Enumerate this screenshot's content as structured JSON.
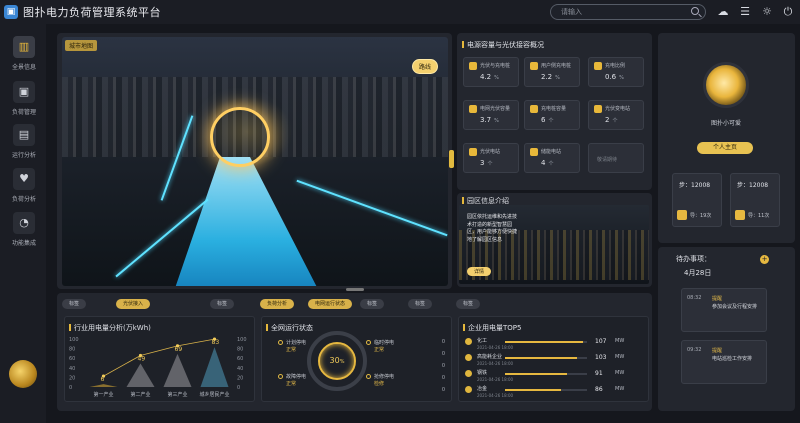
{
  "app": {
    "title": "图扑电力负荷管理系统平台",
    "search_placeholder": "请输入"
  },
  "sidebar": {
    "items": [
      {
        "label": "全景信息",
        "icon": "overview-icon"
      },
      {
        "label": "负荷管理",
        "icon": "monitor-icon"
      },
      {
        "label": "运行分析",
        "icon": "analysis-icon"
      },
      {
        "label": "负荷分析",
        "icon": "heart-icon"
      },
      {
        "label": "功能集成",
        "icon": "pie-icon"
      }
    ]
  },
  "scene": {
    "tag": "城市地图",
    "button": "路线"
  },
  "capacity": {
    "title": "电源容量与光伏接容概况",
    "cards": [
      {
        "label": "光伏与充电桩",
        "value": "4.2",
        "unit": "%"
      },
      {
        "label": "用户侧充电桩",
        "value": "2.2",
        "unit": "%"
      },
      {
        "label": "充电比例",
        "value": "0.6",
        "unit": "%"
      },
      {
        "label": "电网光伏容量",
        "value": "3.7",
        "unit": "%"
      },
      {
        "label": "充电桩容量",
        "value": "6",
        "unit": "个"
      },
      {
        "label": "光伏变电站",
        "value": "2",
        "unit": "个"
      },
      {
        "label": "光伏电站",
        "value": "3",
        "unit": "个"
      },
      {
        "label": "储能电站",
        "value": "4",
        "unit": "个"
      }
    ],
    "empty_label": "敬请期待"
  },
  "intro": {
    "title": "园区信息介绍",
    "text": "园区依托运维和先进技术打造的新型智慧园区，用户能够方便快捷地了解园区信息",
    "button": "详情"
  },
  "tabs": [
    {
      "label": "标签",
      "active": false
    },
    {
      "label": "光伏接入",
      "active": true
    },
    {
      "label": "标签",
      "active": false
    },
    {
      "label": "负荷分析",
      "active": true
    },
    {
      "label": "电网运行状态",
      "active": true
    },
    {
      "label": "标签",
      "active": false
    },
    {
      "label": "标签",
      "active": false
    },
    {
      "label": "标签",
      "active": false
    }
  ],
  "chart_panel": {
    "title": "行业用电量分析(万kWh)",
    "left_ticks": [
      "100",
      "80",
      "60",
      "40",
      "20",
      "0"
    ],
    "right_ticks": [
      "100",
      "80",
      "60",
      "40",
      "20",
      "0"
    ]
  },
  "chart_data": {
    "type": "area",
    "title": "行业用电量分析(万kWh)",
    "categories": [
      "第一产业",
      "第二产业",
      "第三产业",
      "城乡居民产业"
    ],
    "values": [
      6,
      49,
      69,
      83
    ],
    "ylim": [
      0,
      100
    ]
  },
  "gauge_panel": {
    "title": "全网运行状态",
    "value": "30",
    "unit": "%",
    "legend": [
      {
        "label": "计划停电",
        "status": "正常"
      },
      {
        "label": "故障停电",
        "status": "正常"
      },
      {
        "label": "临时停电",
        "status": "正常"
      },
      {
        "label": "抢修停电",
        "status": "检修"
      }
    ],
    "scale": [
      "0",
      "0",
      "0",
      "0",
      "0"
    ]
  },
  "ranking": {
    "title": "企业用电量TOP5",
    "rows": [
      {
        "name": "化工",
        "date": "2021-04-26 18:00",
        "value": "107",
        "unit": "MW",
        "pct": 95
      },
      {
        "name": "高能耗企业",
        "date": "2021-04-26 18:00",
        "value": "103",
        "unit": "MW",
        "pct": 88
      },
      {
        "name": "钢铁",
        "date": "2021-04-26 18:00",
        "value": "91",
        "unit": "MW",
        "pct": 75
      },
      {
        "name": "冶金",
        "date": "2021-04-26 18:00",
        "value": "86",
        "unit": "MW",
        "pct": 68
      }
    ]
  },
  "profile": {
    "name": "图扑小可爱",
    "center_button": "个人主页",
    "cards": [
      {
        "title": "步：12008",
        "label": "导：19次"
      },
      {
        "title": "步：12008",
        "label": "导：11次"
      }
    ]
  },
  "todo": {
    "title": "待办事项：",
    "date": "4月28日",
    "items": [
      {
        "time": "08:32",
        "tag": "提醒",
        "text": "参加会议及行程安排"
      },
      {
        "time": "09:32",
        "tag": "提醒",
        "text": "电站巡检工作安排"
      }
    ]
  },
  "colors": {
    "accent": "#e6b840",
    "water": "#2bb7ea",
    "panel": "#23262e"
  }
}
